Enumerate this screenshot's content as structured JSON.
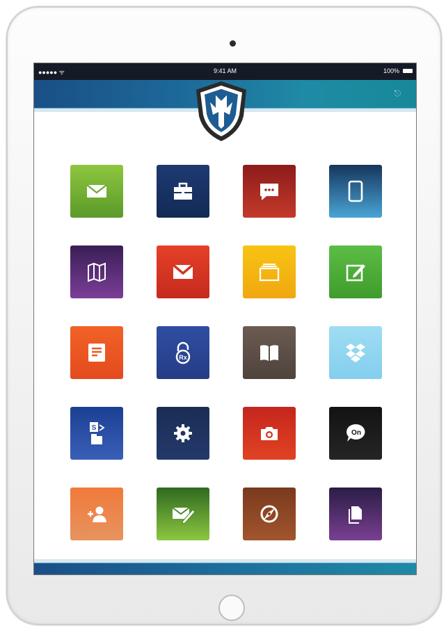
{
  "status_bar": {
    "signal": "●●●●● ᯤ",
    "time": "9:41 AM",
    "battery": "100%"
  },
  "header": {
    "logout_icon": "logout-icon"
  },
  "apps": [
    {
      "icon": "envelope-icon",
      "color_top": "#8fc63f",
      "color_bottom": "#5a9a2a"
    },
    {
      "icon": "briefcase-icon",
      "color_top": "#1f3a72",
      "color_bottom": "#122a55"
    },
    {
      "icon": "chat-bubble-icon",
      "color_top": "#8d1b1b",
      "color_bottom": "#c33a2a"
    },
    {
      "icon": "tablet-icon",
      "color_top": "#15365c",
      "color_bottom": "#4aa4d6"
    },
    {
      "icon": "map-icon",
      "color_top": "#3a1e55",
      "color_bottom": "#7b3e97"
    },
    {
      "icon": "gmail-icon",
      "color_top": "#e64028",
      "color_bottom": "#c52a1e"
    },
    {
      "icon": "slides-icon",
      "color_top": "#f7c412",
      "color_bottom": "#f1a711"
    },
    {
      "icon": "compose-icon",
      "color_top": "#5cbd45",
      "color_bottom": "#3f9c2c"
    },
    {
      "icon": "document-icon",
      "color_top": "#f26226",
      "color_bottom": "#e34b1f"
    },
    {
      "icon": "rx-lock-icon",
      "color_top": "#2f4ea2",
      "color_bottom": "#263c85"
    },
    {
      "icon": "book-icon",
      "color_top": "#6b5b52",
      "color_bottom": "#4f433c"
    },
    {
      "icon": "dropbox-icon",
      "color_top": "#9fdcf3",
      "color_bottom": "#83cfee"
    },
    {
      "icon": "sharepoint-icon",
      "color_top": "#1b3f92",
      "color_bottom": "#3a5fb7"
    },
    {
      "icon": "settings-gear-icon",
      "color_top": "#1b2d55",
      "color_bottom": "#23396b"
    },
    {
      "icon": "camera-icon",
      "color_top": "#c5261e",
      "color_bottom": "#e04322"
    },
    {
      "icon": "chat-on-icon",
      "color_top": "#131313",
      "color_bottom": "#252525"
    },
    {
      "icon": "add-contact-icon",
      "color_top": "#f07a3a",
      "color_bottom": "#e7935f"
    },
    {
      "icon": "mail-edit-icon",
      "color_top": "#2f6a22",
      "color_bottom": "#8dc63f"
    },
    {
      "icon": "compass-icon",
      "color_top": "#7a3a1e",
      "color_bottom": "#a1552c"
    },
    {
      "icon": "files-icon",
      "color_top": "#2a1d45",
      "color_bottom": "#7a3f92"
    }
  ]
}
